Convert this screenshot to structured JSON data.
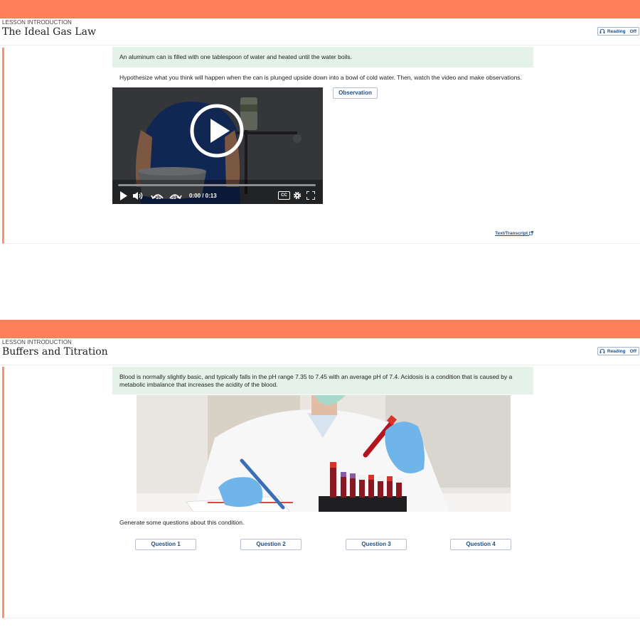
{
  "panel1": {
    "eyebrow": "LESSON INTRODUCTION",
    "title": "The Ideal Gas Law",
    "reading": {
      "label": "Reading",
      "state": "Off"
    },
    "callout": "An aluminum can is filled with one tablespoon of water and heated until the water boils.",
    "prompt": "Hypothesize what you think will happen when the can is plunged upside down into a bowl of cold water. Then, watch the video and make observations.",
    "video": {
      "time": "0:00 / 0:13",
      "skip_back": "10",
      "skip_forward": "10",
      "captions": "CC",
      "progress": 0
    },
    "observation_button": "Observation",
    "transcript_link": "Text/Transcript"
  },
  "panel2": {
    "eyebrow": "LESSON INTRODUCTION",
    "title": "Buffers and Titration",
    "reading": {
      "label": "Reading",
      "state": "Off"
    },
    "callout": "Blood is normally slightly basic, and typically falls in the pH range 7.35 to 7.45 with an average pH of 7.4. Acidosis is a condition that is caused by a metabolic imbalance that increases the acidity of the blood.",
    "prompt": "Generate some questions about this condition.",
    "questions": [
      "Question 1",
      "Question 2",
      "Question 3",
      "Question 4"
    ]
  },
  "colors": {
    "accent": "#ff7f5b",
    "callout_bg": "#e4f2ea",
    "link": "#1f4f87"
  }
}
